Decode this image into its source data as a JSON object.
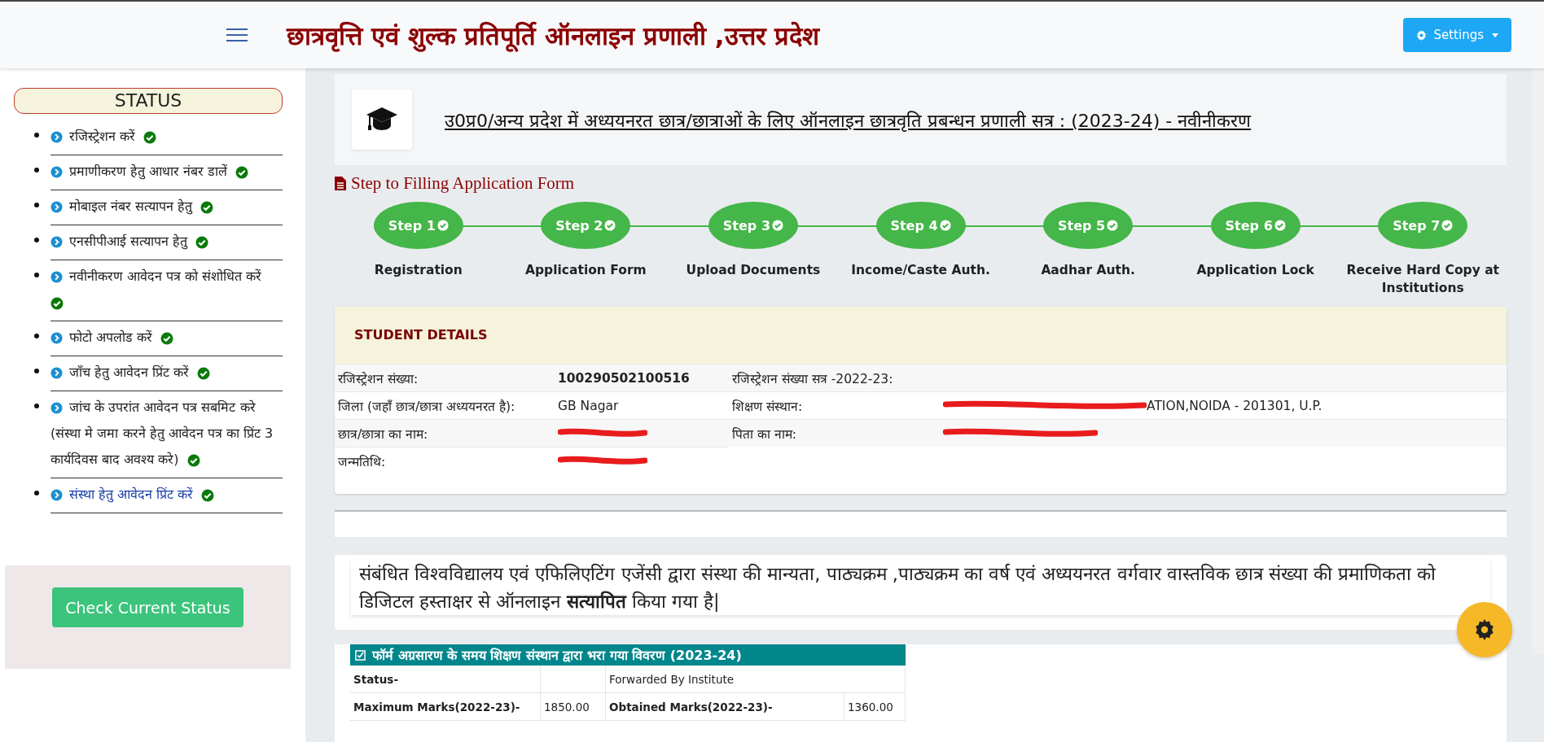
{
  "header": {
    "title": "छात्रवृत्ति एवं शुल्क प्रतिपूर्ति ऑनलाइन प्रणाली ,उत्तर प्रदेश",
    "settings_button": "Settings"
  },
  "sidebar": {
    "heading": "STATUS",
    "items": [
      {
        "label": "रजिस्ट्रेशन करें",
        "done": true,
        "selected": false
      },
      {
        "label": "प्रमाणीकरण हेतु आधार नंबर डालें",
        "done": true,
        "selected": false
      },
      {
        "label": "मोबाइल नंबर सत्यापन हेतु",
        "done": true,
        "selected": false
      },
      {
        "label": "एनसीपीआई सत्यापन हेतु",
        "done": true,
        "selected": false
      },
      {
        "label": "नवीनीकरण आवेदन पत्र को संशोधित करें",
        "done": true,
        "selected": false
      },
      {
        "label": "फोटो अपलोड करें",
        "done": true,
        "selected": false
      },
      {
        "label": "जाँच हेतु आवेदन प्रिंट करें",
        "done": true,
        "selected": false
      },
      {
        "label": "जांच के उपरांत आवेदन पत्र सबमिट करे (संस्था मे जमा करने हेतु आवेदन पत्र का प्रिंट 3 कार्यदिवस बाद अवश्य करे)",
        "done": true,
        "selected": false
      },
      {
        "label": "संस्था हेतु आवेदन प्रिंट करें",
        "done": true,
        "selected": true
      }
    ],
    "check_button": "Check Current Status"
  },
  "page_title": "उ0प्र0/अन्य प्रदेश में अध्ययनरत छात्र/छात्राओं के लिए ऑनलाइन छात्रवृति प्रबन्धन प्रणाली सत्र : (2023-24) - नवीनीकरण",
  "steps_heading": "Step to Filling Application Form",
  "steps": [
    {
      "label": "Step 1",
      "done": true,
      "caption": "Registration"
    },
    {
      "label": "Step 2",
      "done": true,
      "caption": "Application Form"
    },
    {
      "label": "Step 3",
      "done": true,
      "caption": "Upload Documents"
    },
    {
      "label": "Step 4",
      "done": true,
      "caption": "Income/Caste Auth."
    },
    {
      "label": "Step 5",
      "done": true,
      "caption": "Aadhar Auth."
    },
    {
      "label": "Step 6",
      "done": true,
      "caption": "Application Lock"
    },
    {
      "label": "Step 7",
      "done": true,
      "caption": "Receive Hard Copy at Institutions"
    }
  ],
  "student_details": {
    "title": "STUDENT DETAILS",
    "rows": [
      [
        {
          "label": "रजिस्ट्रेशन संख्या:",
          "value": "100290502100516",
          "bold": true,
          "redacted": false
        },
        {
          "label": "रजिस्ट्रेशन संख्या सत्र -2022-23:",
          "redacted": false
        }
      ],
      [
        {
          "label": "जिला (जहाँ छात्र/छात्रा अध्ययनरत है):",
          "value": "GB Nagar",
          "redacted": false
        },
        {
          "label": "शिक्षण संस्थान:",
          "value": "ATION,NOIDA - 201301, U.P.",
          "redacted": true
        }
      ],
      [
        {
          "label": "छात्र/छात्रा का नाम:",
          "redacted": true
        },
        {
          "label": "पिता का नाम:",
          "redacted": true
        }
      ],
      [
        {
          "label": "जन्मतिथि:",
          "redacted": true
        }
      ]
    ]
  },
  "notice": "संबंधित विश्वविद्यालय एवं एफिलिएटिंग एजेंसी द्वारा संस्था की मान्यता, पाठ्यक्रम ,पाठ्यक्रम का वर्ष एवं अध्ययनरत वर्गवार वास्तविक छात्र संख्या की प्रमाणिकता को डिजिटल हस्ताक्षर से ऑनलाइन **सत्यापित** किया गया है|",
  "forward_table": {
    "title": "फॉर्म अग्रसारण के समय शिक्षण संस्थान द्वारा भरा गया विवरण (2023-24)",
    "rows": [
      [
        {
          "text": "Status-",
          "kind": "label"
        },
        {
          "text": "",
          "kind": "value"
        },
        {
          "text": "Forwarded By Institute",
          "kind": "value"
        }
      ],
      [
        {
          "text": "Maximum Marks(2022-23)-",
          "kind": "label"
        },
        {
          "text": "1850.00",
          "kind": "value"
        },
        {
          "text": "Obtained Marks(2022-23)-",
          "kind": "label"
        },
        {
          "text": "1360.00",
          "kind": "value"
        }
      ]
    ]
  }
}
